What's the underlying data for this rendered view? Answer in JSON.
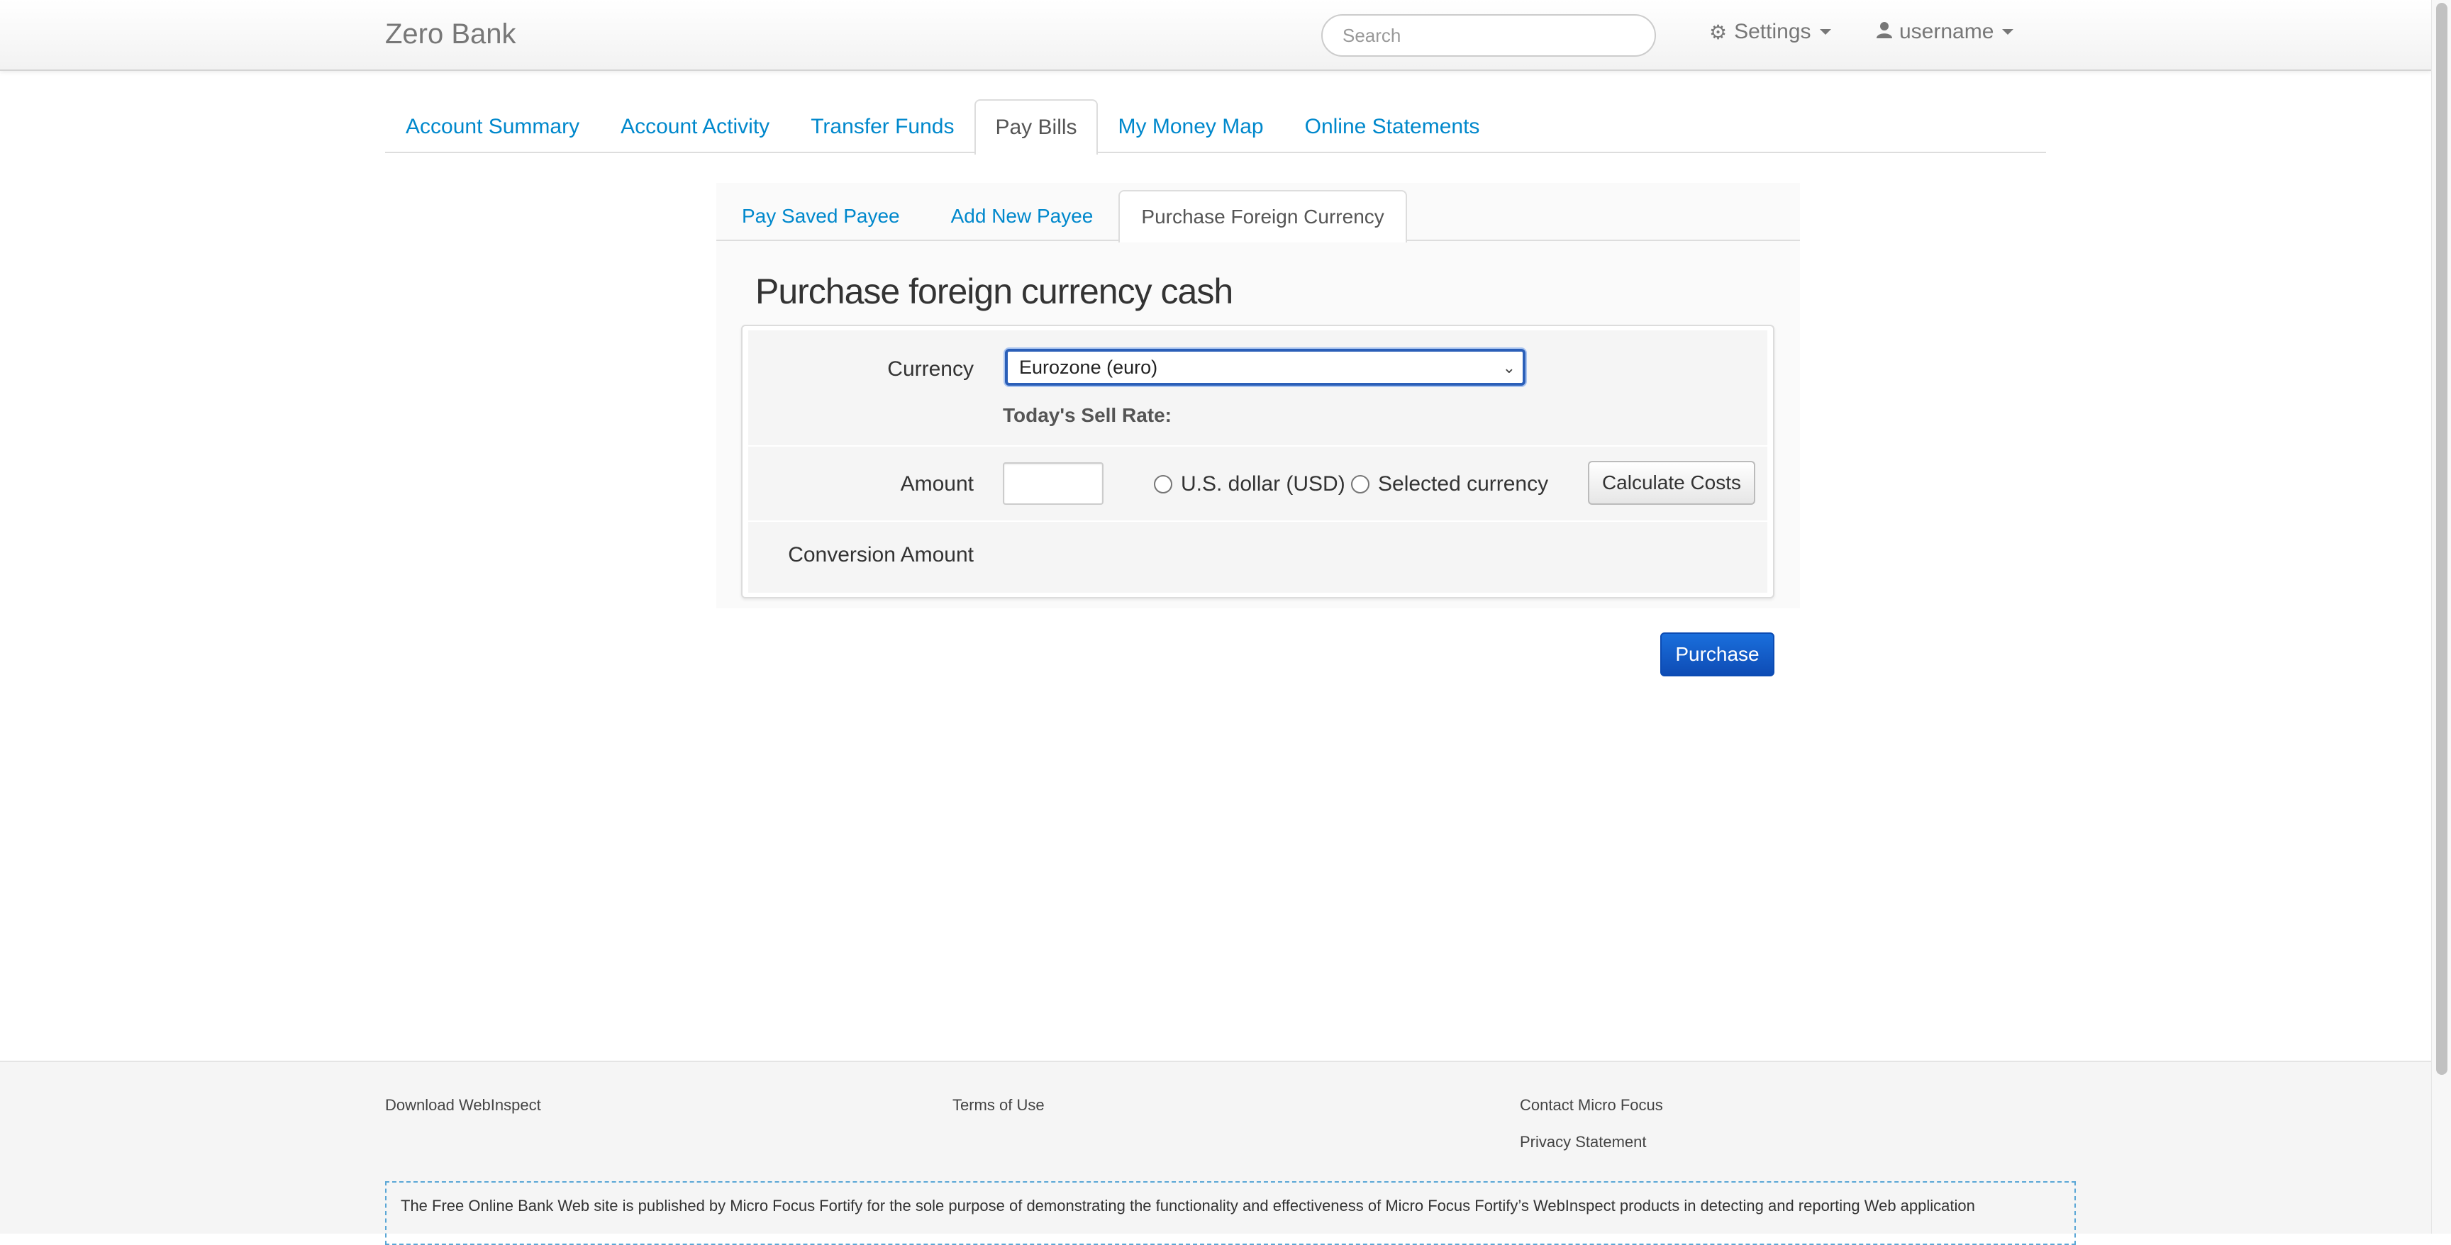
{
  "navbar": {
    "brand": "Zero Bank",
    "search_placeholder": "Search",
    "settings_label": "Settings",
    "user_label": "username"
  },
  "main_tabs": [
    {
      "label": "Account Summary",
      "active": false
    },
    {
      "label": "Account Activity",
      "active": false
    },
    {
      "label": "Transfer Funds",
      "active": false
    },
    {
      "label": "Pay Bills",
      "active": true
    },
    {
      "label": "My Money Map",
      "active": false
    },
    {
      "label": "Online Statements",
      "active": false
    }
  ],
  "sub_tabs": [
    {
      "label": "Pay Saved Payee",
      "active": false
    },
    {
      "label": "Add New Payee",
      "active": false
    },
    {
      "label": "Purchase Foreign Currency",
      "active": true
    }
  ],
  "form": {
    "title": "Purchase foreign currency cash",
    "currency_label": "Currency",
    "currency_selected": "Eurozone (euro)",
    "sell_rate_label": "Today's Sell Rate:",
    "amount_label": "Amount",
    "amount_value": "",
    "radio_usd_label": "U.S. dollar (USD)",
    "radio_selected_label": "Selected currency",
    "calculate_label": "Calculate Costs",
    "conversion_label": "Conversion Amount",
    "purchase_label": "Purchase"
  },
  "footer": {
    "download": "Download WebInspect",
    "terms": "Terms of Use",
    "contact": "Contact Micro Focus",
    "privacy": "Privacy Statement",
    "disclaimer": "The Free Online Bank Web site is published by Micro Focus Fortify for the sole purpose of demonstrating the functionality and effectiveness of Micro Focus Fortify’s WebInspect products in detecting and reporting Web application"
  },
  "colors": {
    "link": "#0088cc",
    "primary_button": "#0e4cb5",
    "brand_text": "#777777"
  },
  "icons": {
    "settings": "gear-icon",
    "user": "user-icon",
    "dropdown": "caret-down-icon"
  }
}
